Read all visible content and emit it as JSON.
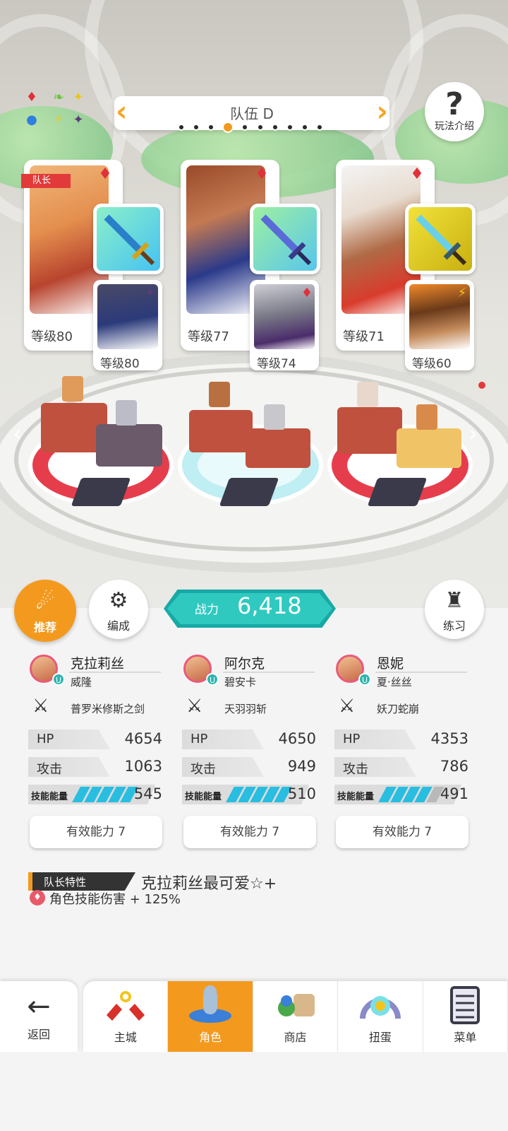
{
  "header": {
    "team_name": "队伍 D",
    "prev_arrow": "‹",
    "next_arrow": "›",
    "pager_count": 10,
    "pager_active_index": 3,
    "help_label": "玩法介绍",
    "help_icon": "?"
  },
  "element_cycle_icons": [
    "red-diamond-icon",
    "green-leaf-icon",
    "yellow-sparkle-icon",
    "blue-orb-icon",
    "lightning-icon",
    "dark-star-icon"
  ],
  "party_cards": [
    {
      "leader_tag": "队长",
      "main_level": "等级80",
      "main_element": "♦",
      "sub_level": "等级80",
      "sub_element": "✦",
      "weapon_color": "#63d8f2"
    },
    {
      "main_level": "等级77",
      "main_element": "♦",
      "sub_level": "等级74",
      "sub_element": "♦",
      "weapon_color": "#74d9f0"
    },
    {
      "main_level": "等级71",
      "main_element": "♦",
      "sub_level": "等级60",
      "sub_element": "⚡",
      "weapon_color": "#e6d218"
    }
  ],
  "actions": {
    "recommend_label": "推荐",
    "formation_label": "编成",
    "practice_label": "练习"
  },
  "power": {
    "label": "战力",
    "value": "6,418"
  },
  "characters": [
    {
      "name": "克拉莉丝",
      "partner": "威隆",
      "weapon": "普罗米修斯之剑",
      "hp_label": "HP",
      "hp": "4654",
      "atk_label": "攻击",
      "atk": "1063",
      "skill_label": "技能能量",
      "skill_energy": "545",
      "skill_segments_filled": 5,
      "effective_label": "有效能力 7",
      "avatar_color": "#e85a7a"
    },
    {
      "name": "阿尔克",
      "partner": "碧安卡",
      "weapon": "天羽羽斩",
      "hp_label": "HP",
      "hp": "4650",
      "atk_label": "攻击",
      "atk": "949",
      "skill_label": "技能能量",
      "skill_energy": "510",
      "skill_segments_filled": 5,
      "effective_label": "有效能力 7",
      "avatar_color": "#e85a7a"
    },
    {
      "name": "恩妮",
      "partner": "夏·丝丝",
      "weapon": "妖刀蛇崩",
      "hp_label": "HP",
      "hp": "4353",
      "atk_label": "攻击",
      "atk": "786",
      "skill_label": "技能能量",
      "skill_energy": "491",
      "skill_segments_filled": 4,
      "effective_label": "有效能力 7",
      "avatar_color": "#e85a7a"
    }
  ],
  "leader_trait": {
    "tag_label": "队长特性",
    "name": "克拉莉丝最可爱☆+",
    "effect": "角色技能伤害 + 125%"
  },
  "nav": {
    "back_label": "返回",
    "tabs": [
      {
        "label": "主城",
        "icon": "castle-icon"
      },
      {
        "label": "角色",
        "icon": "character-icon",
        "active": true
      },
      {
        "label": "商店",
        "icon": "shop-bag-icon"
      },
      {
        "label": "扭蛋",
        "icon": "gacha-icon"
      },
      {
        "label": "菜单",
        "icon": "menu-list-icon"
      }
    ]
  },
  "colors": {
    "accent_orange": "#f39a1e",
    "teal": "#2fc9c0",
    "element_red": "#e0303a",
    "skill_blue": "#29bde0"
  }
}
